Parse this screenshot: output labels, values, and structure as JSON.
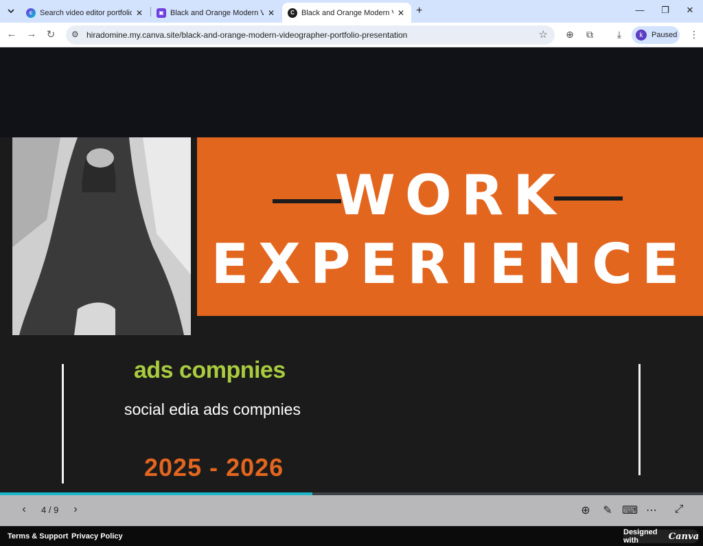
{
  "browser": {
    "tabs": [
      {
        "title": "Search video editor portfolio - C",
        "favicon": "canva-search-icon",
        "active": false
      },
      {
        "title": "Black and Orange Modern Vide",
        "favicon": "slides-icon",
        "active": false
      },
      {
        "title": "Black and Orange Modern Vide",
        "favicon": "canva-c-icon",
        "active": true
      }
    ],
    "url": "hiradomine.my.canva.site/black-and-orange-modern-videographer-portfolio-presentation",
    "profile_initial": "k",
    "profile_status": "Paused"
  },
  "slide": {
    "title_line1": "WORK",
    "title_line2": "EXPERIENCE",
    "subtitle": "ads compnies",
    "description": "social edia ads compnies",
    "years": "2025 - 2026",
    "colors": {
      "accent": "#e3661f",
      "subtitle": "#a9cc3f",
      "background": "#1b1b1b"
    }
  },
  "viewer": {
    "page_indicator": "4 / 9",
    "progress_fraction": 0.444
  },
  "footer": {
    "terms": "Terms & Support",
    "privacy": "Privacy Policy",
    "designed_with": "Designed with",
    "brand": "Canva"
  }
}
